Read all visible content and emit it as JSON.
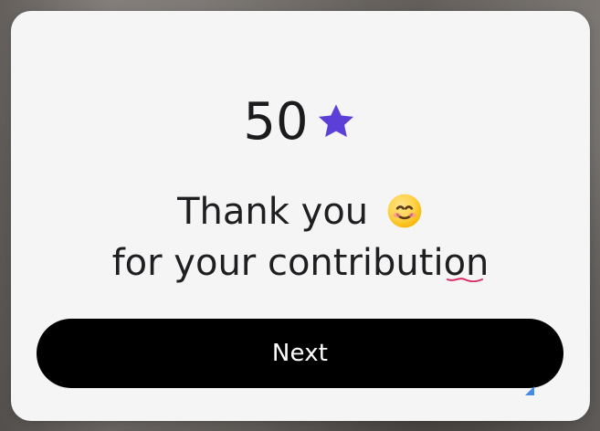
{
  "modal": {
    "points_value": "50",
    "points_icon": "star-icon",
    "message_line1": "Thank you",
    "message_emoji": "smiling-face-emoji",
    "message_line2": "for your contribution",
    "next_button_label": "Next"
  },
  "colors": {
    "star": "#5b3fd6",
    "button_bg": "#000000",
    "button_text": "#ffffff",
    "modal_bg": "#f5f5f6",
    "spell_underline": "#d92d6a",
    "corner_accent": "#2f7fe8"
  }
}
